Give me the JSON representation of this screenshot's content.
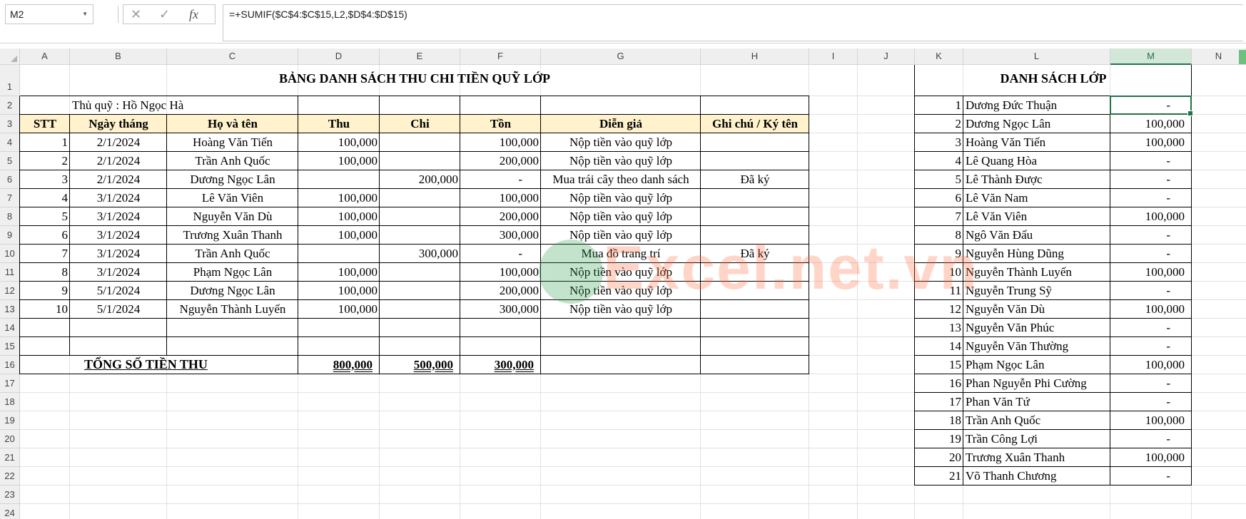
{
  "formula_bar": {
    "name_box": "M2",
    "fx_label": "fx",
    "formula": "=+SUMIF($C$4:$C$15,L2,$D$4:$D$15)"
  },
  "columns": [
    "A",
    "B",
    "C",
    "D",
    "E",
    "F",
    "G",
    "H",
    "I",
    "J",
    "K",
    "L",
    "M",
    "N"
  ],
  "selected_column": "M",
  "rows": [
    "1",
    "2",
    "3",
    "4",
    "5",
    "6",
    "7",
    "8",
    "9",
    "10",
    "11",
    "12",
    "13",
    "14",
    "15",
    "16",
    "17",
    "18",
    "19",
    "20",
    "21",
    "22",
    "23",
    "24"
  ],
  "main_table": {
    "title": "BẢNG DANH SÁCH THU CHI TIỀN QUỸ LỚP",
    "treasurer": "Thủ quỹ : Hồ Ngọc Hà",
    "headers": [
      "STT",
      "Ngày tháng",
      "Họ và tên",
      "Thu",
      "Chi",
      "Tồn",
      "Diễn giả",
      "Ghi chú / Ký tên"
    ],
    "rows": [
      [
        "1",
        "2/1/2024",
        "Hoàng Văn Tiến",
        "100,000",
        "",
        "100,000",
        "Nộp tiền vào quỹ lớp",
        ""
      ],
      [
        "2",
        "2/1/2024",
        "Trần Anh Quốc",
        "100,000",
        "",
        "200,000",
        "Nộp tiền vào quỹ lớp",
        ""
      ],
      [
        "3",
        "2/1/2024",
        "Dương Ngọc Lân",
        "",
        "200,000",
        "-",
        "Mua trái cây theo danh sách",
        "Đã ký"
      ],
      [
        "4",
        "3/1/2024",
        "Lê Văn Viên",
        "100,000",
        "",
        "100,000",
        "Nộp tiền vào quỹ lớp",
        ""
      ],
      [
        "5",
        "3/1/2024",
        "Nguyễn Văn Dù",
        "100,000",
        "",
        "200,000",
        "Nộp tiền vào quỹ lớp",
        ""
      ],
      [
        "6",
        "3/1/2024",
        "Trương Xuân Thanh",
        "100,000",
        "",
        "300,000",
        "Nộp tiền vào quỹ lớp",
        ""
      ],
      [
        "7",
        "3/1/2024",
        "Trần Anh Quốc",
        "",
        "300,000",
        "-",
        "Mua đồ trang trí",
        "Đã ký"
      ],
      [
        "8",
        "3/1/2024",
        "Phạm Ngọc Lân",
        "100,000",
        "",
        "100,000",
        "Nộp tiền vào quỹ lớp",
        ""
      ],
      [
        "9",
        "5/1/2024",
        "Dương Ngọc Lân",
        "100,000",
        "",
        "200,000",
        "Nộp tiền vào quỹ lớp",
        ""
      ],
      [
        "10",
        "5/1/2024",
        "Nguyễn Thành Luyến",
        "100,000",
        "",
        "300,000",
        "Nộp tiền vào quỹ lớp",
        ""
      ]
    ],
    "total_label": "TỔNG SỐ TIỀN THU",
    "total_thu": "800,000",
    "total_chi": "500,000",
    "total_ton": "300,000"
  },
  "class_list": {
    "title": "DANH SÁCH LỚP",
    "rows": [
      [
        "1",
        "Dương Đức Thuận",
        "-"
      ],
      [
        "2",
        "Dương Ngọc Lân",
        "100,000"
      ],
      [
        "3",
        "Hoàng Văn Tiến",
        "100,000"
      ],
      [
        "4",
        "Lê Quang Hòa",
        "-"
      ],
      [
        "5",
        "Lê Thành Được",
        "-"
      ],
      [
        "6",
        "Lê Văn Nam",
        "-"
      ],
      [
        "7",
        "Lê Văn Viên",
        "100,000"
      ],
      [
        "8",
        "Ngô Văn Đấu",
        "-"
      ],
      [
        "9",
        "Nguyễn Hùng Dũng",
        "-"
      ],
      [
        "10",
        "Nguyễn Thành Luyến",
        "100,000"
      ],
      [
        "11",
        "Nguyễn Trung Sỹ",
        "-"
      ],
      [
        "12",
        "Nguyễn Văn Dù",
        "100,000"
      ],
      [
        "13",
        "Nguyễn Văn Phúc",
        "-"
      ],
      [
        "14",
        "Nguyễn Văn Thường",
        "-"
      ],
      [
        "15",
        "Phạm Ngọc Lân",
        "100,000"
      ],
      [
        "16",
        "Phan Nguyễn Phi Cường",
        "-"
      ],
      [
        "17",
        "Phan Văn Tứ",
        "-"
      ],
      [
        "18",
        "Trần Anh Quốc",
        "100,000"
      ],
      [
        "19",
        "Trần Công Lợi",
        "-"
      ],
      [
        "20",
        "Trương Xuân Thanh",
        "100,000"
      ],
      [
        "21",
        "Võ Thanh Chương",
        "-"
      ]
    ]
  },
  "watermark": "Excel.net.vn",
  "colors": {
    "accent": "#217346",
    "header_fill": "#fff2cc",
    "watermark_text": "#ff6a3d",
    "watermark_logo": "#2e9e4f"
  }
}
